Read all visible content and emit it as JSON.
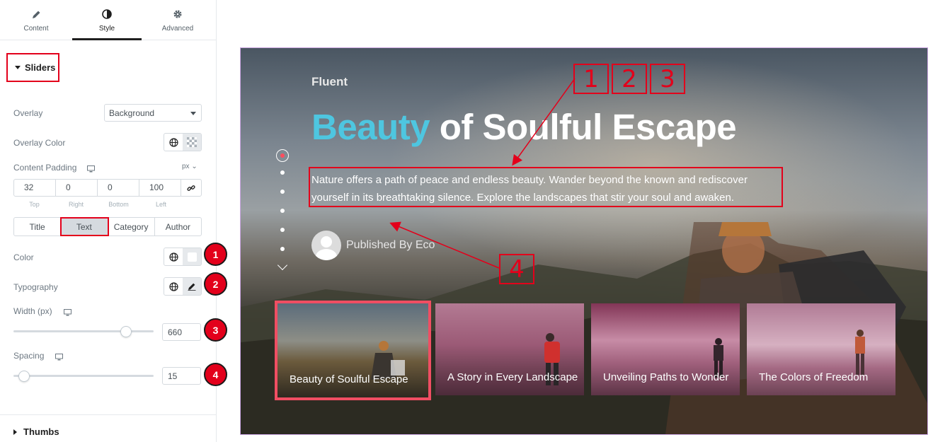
{
  "editor": {
    "tabs": [
      {
        "label": "Content",
        "icon": "pencil-icon"
      },
      {
        "label": "Style",
        "icon": "contrast-icon"
      },
      {
        "label": "Advanced",
        "icon": "gear-icon"
      }
    ],
    "active_tab": "Style",
    "section_title": "Sliders",
    "overlay": {
      "label": "Overlay",
      "value": "Background"
    },
    "overlay_color": {
      "label": "Overlay Color"
    },
    "content_padding": {
      "label": "Content Padding",
      "unit": "px",
      "values": [
        "32",
        "0",
        "0",
        "100"
      ],
      "sides": [
        "Top",
        "Right",
        "Bottom",
        "Left"
      ]
    },
    "element_tabs": [
      "Title",
      "Text",
      "Category",
      "Author"
    ],
    "active_element_tab": "Text",
    "color": {
      "label": "Color"
    },
    "typography": {
      "label": "Typography"
    },
    "width": {
      "label": "Width (px)",
      "value": "660",
      "level": 0.79
    },
    "spacing": {
      "label": "Spacing",
      "value": "15",
      "level": 0.07
    },
    "badges": [
      "1",
      "2",
      "3",
      "4"
    ],
    "thumbs_section": "Thumbs"
  },
  "preview": {
    "brand": "Fluent",
    "title_accent": "Beauty",
    "title_rest": " of Soulful Escape",
    "description": "Nature offers a path of peace and endless beauty. Wander beyond the known and rediscover yourself in its breathtaking silence. Explore the landscapes that stir your soul and awaken.",
    "author": "Published By Eco",
    "annotations": [
      "1",
      "2",
      "3",
      "4"
    ],
    "thumbnails": [
      {
        "title": "Beauty of Soulful Escape"
      },
      {
        "title": "A Story in Every Landscape"
      },
      {
        "title": "Unveiling Paths to Wonder"
      },
      {
        "title": "The Colors of Freedom"
      }
    ],
    "accent_color": "#4ec6e0",
    "annotation_color": "#e3001b"
  }
}
